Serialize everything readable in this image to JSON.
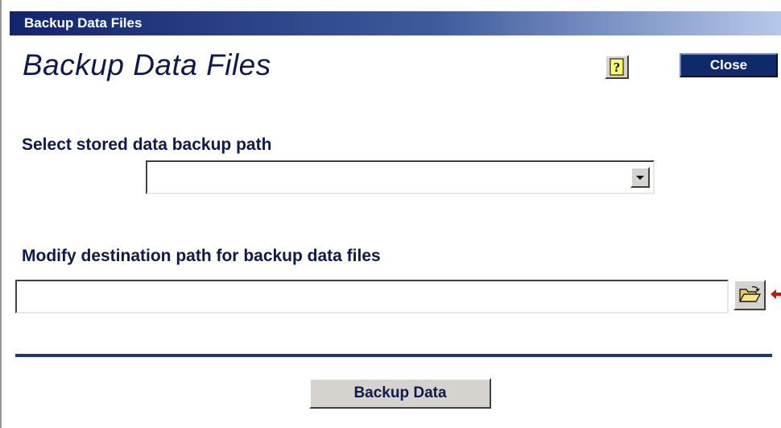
{
  "window": {
    "title": "Backup Data Files"
  },
  "header": {
    "page_title": "Backup Data Files",
    "help_icon": "help-question-icon",
    "close_label": "Close"
  },
  "stored_path": {
    "label": "Select stored data backup path",
    "selected_value": ""
  },
  "destination": {
    "label": "Modify destination path for backup data files",
    "value": "",
    "browse_icon": "open-folder-icon"
  },
  "actions": {
    "backup_label": "Backup Data"
  },
  "colors": {
    "titlebar_start": "#13246b",
    "titlebar_end": "#b7c9ea",
    "heading_text": "#0e1a4e",
    "close_button_bg": "#0e2a6b",
    "divider": "#1b3a67",
    "button_face": "#d6d3ce",
    "pointer_arrow": "#d01010"
  }
}
